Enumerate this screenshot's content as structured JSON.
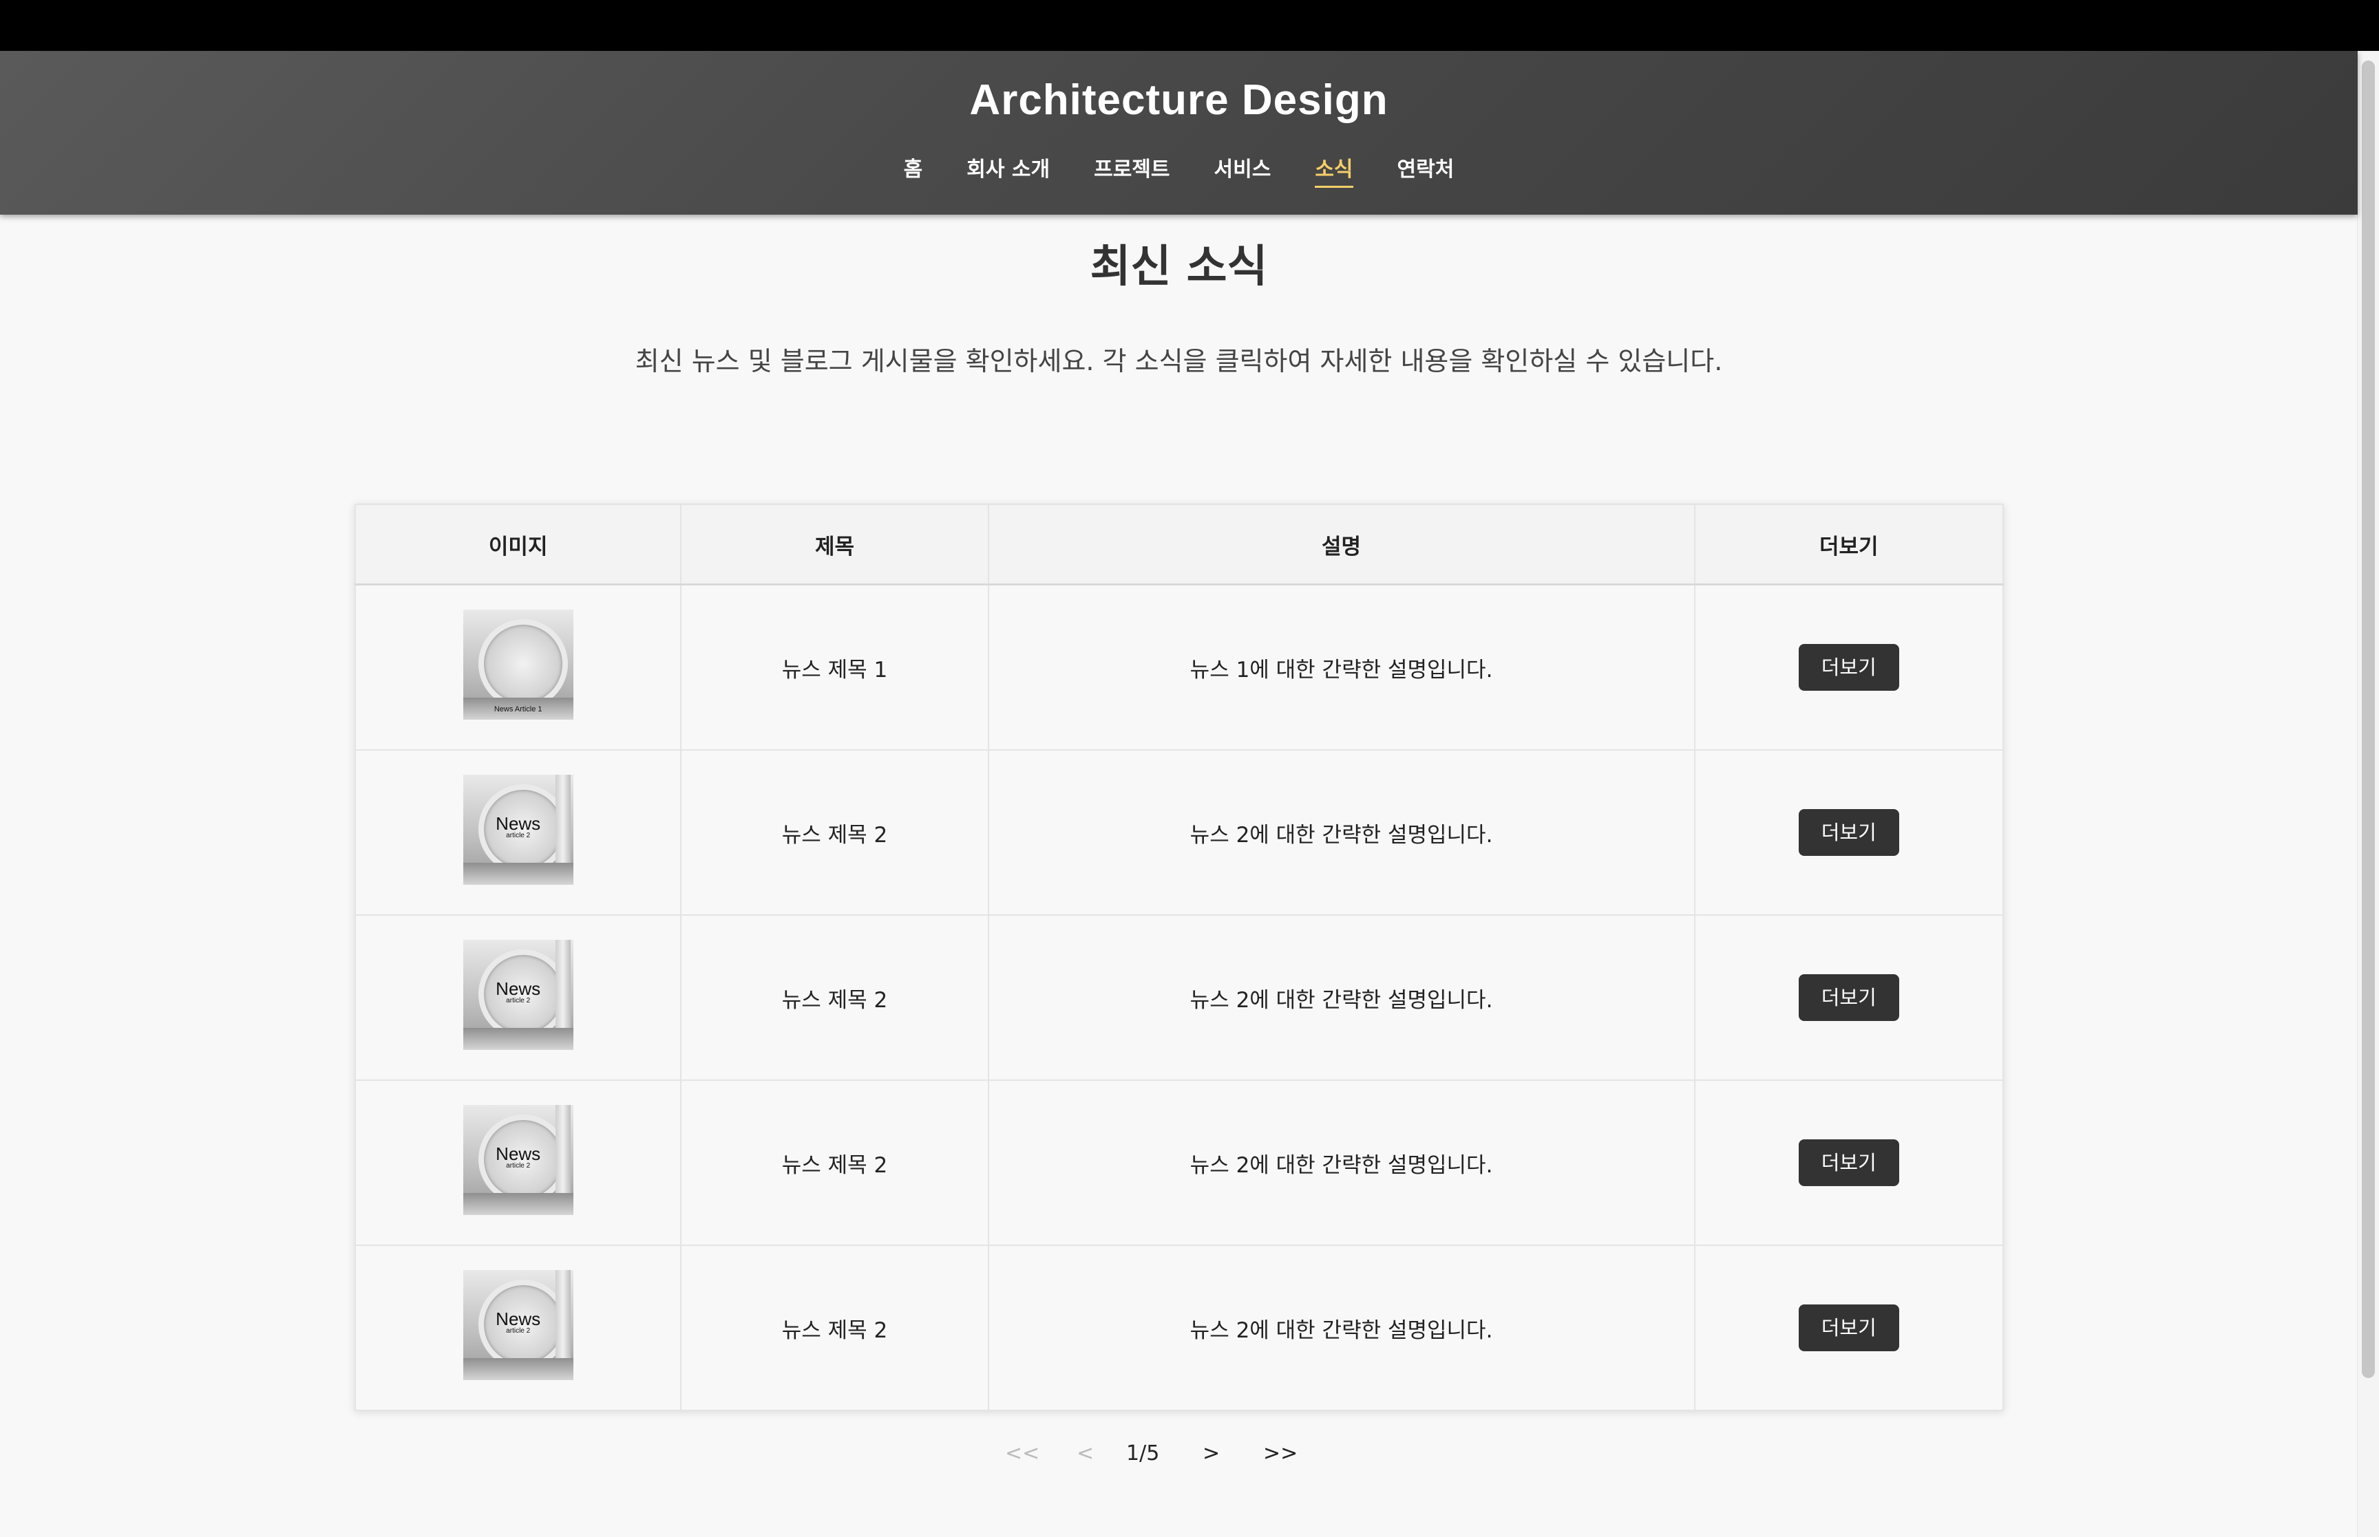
{
  "site": {
    "title": "Architecture Design"
  },
  "nav": {
    "items": [
      {
        "label": "홈"
      },
      {
        "label": "회사 소개"
      },
      {
        "label": "프로젝트"
      },
      {
        "label": "서비스"
      },
      {
        "label": "소식",
        "active": true
      },
      {
        "label": "연락처"
      }
    ],
    "active_color": "#f5cf6a"
  },
  "main": {
    "heading": "최신 소식",
    "intro": "최신 뉴스 및 블로그 게시물을 확인하세요. 각 소식을 클릭하여 자세한 내용을 확인하실 수 있습니다."
  },
  "table": {
    "headers": [
      "이미지",
      "제목",
      "설명",
      "더보기"
    ],
    "rows": [
      {
        "thumb_caption": "News Article 1",
        "title": "뉴스 제목 1",
        "description": "뉴스 1에 대한 간략한 설명입니다.",
        "button": "더보기"
      },
      {
        "thumb_caption": "News",
        "thumb_sub": "article 2",
        "title": "뉴스 제목 2",
        "description": "뉴스 2에 대한 간략한 설명입니다.",
        "button": "더보기"
      },
      {
        "thumb_caption": "News",
        "thumb_sub": "article 2",
        "title": "뉴스 제목 2",
        "description": "뉴스 2에 대한 간략한 설명입니다.",
        "button": "더보기"
      },
      {
        "thumb_caption": "News",
        "thumb_sub": "article 2",
        "title": "뉴스 제목 2",
        "description": "뉴스 2에 대한 간략한 설명입니다.",
        "button": "더보기"
      },
      {
        "thumb_caption": "News",
        "thumb_sub": "article 2",
        "title": "뉴스 제목 2",
        "description": "뉴스 2에 대한 간략한 설명입니다.",
        "button": "더보기"
      }
    ]
  },
  "pagination": {
    "first": "<<",
    "prev": "<",
    "current": "1/5",
    "next": ">",
    "last": ">>"
  }
}
